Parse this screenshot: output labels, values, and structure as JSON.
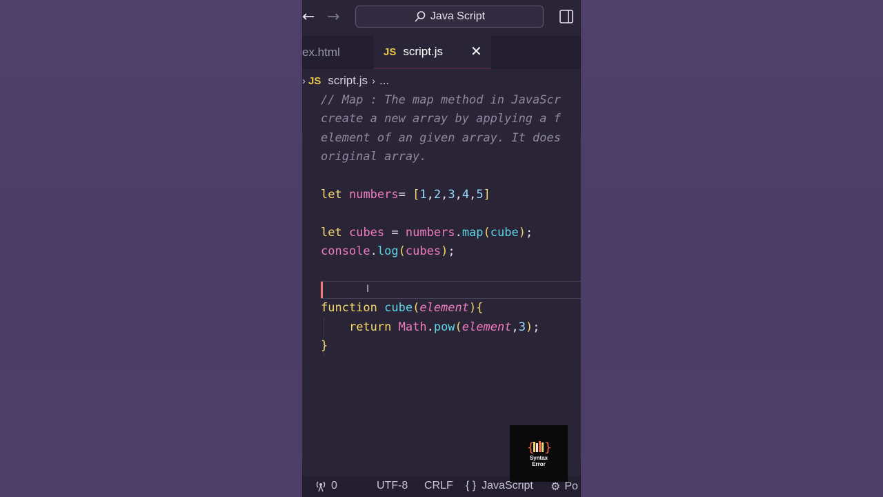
{
  "titlebar": {
    "search_text": "Java Script"
  },
  "tabs": [
    {
      "label": "ex.html",
      "active": false
    },
    {
      "label": "script.js",
      "active": true,
      "badge": "JS"
    }
  ],
  "breadcrumb": {
    "badge": "JS",
    "file": "script.js",
    "rest": "..."
  },
  "code": {
    "comment_lines": [
      "// Map : The map method in JavaScr",
      "create a new array by applying a f",
      "element of an given array. It does",
      "original array."
    ],
    "numbers_line": {
      "kw": "let",
      "name": "numbers",
      "op": "=",
      "values": [
        "1",
        "2",
        "3",
        "4",
        "5"
      ]
    },
    "cubes_line": {
      "kw": "let",
      "name": "cubes",
      "op": "=",
      "obj": "numbers",
      "method": "map",
      "arg": "cube"
    },
    "log_line": {
      "obj": "console",
      "method": "log",
      "arg": "cubes"
    },
    "function_line": {
      "kw": "function",
      "name": "cube",
      "param": "element"
    },
    "return_line": {
      "kw": "return",
      "obj": "Math",
      "method": "pow",
      "param": "element",
      "arg2": "3"
    },
    "close_brace": "}"
  },
  "statusbar": {
    "ports": "0",
    "encoding": "UTF-8",
    "eol": "CRLF",
    "language": "JavaScript",
    "extra": "Po"
  },
  "logo": {
    "line1": "Syntax",
    "line2": "Error"
  },
  "colors": {
    "keyword": "#f5d86a",
    "variable": "#f07bbf",
    "function": "#5ed6e8",
    "comment": "#8e88a0",
    "number": "#9ad8ff"
  }
}
